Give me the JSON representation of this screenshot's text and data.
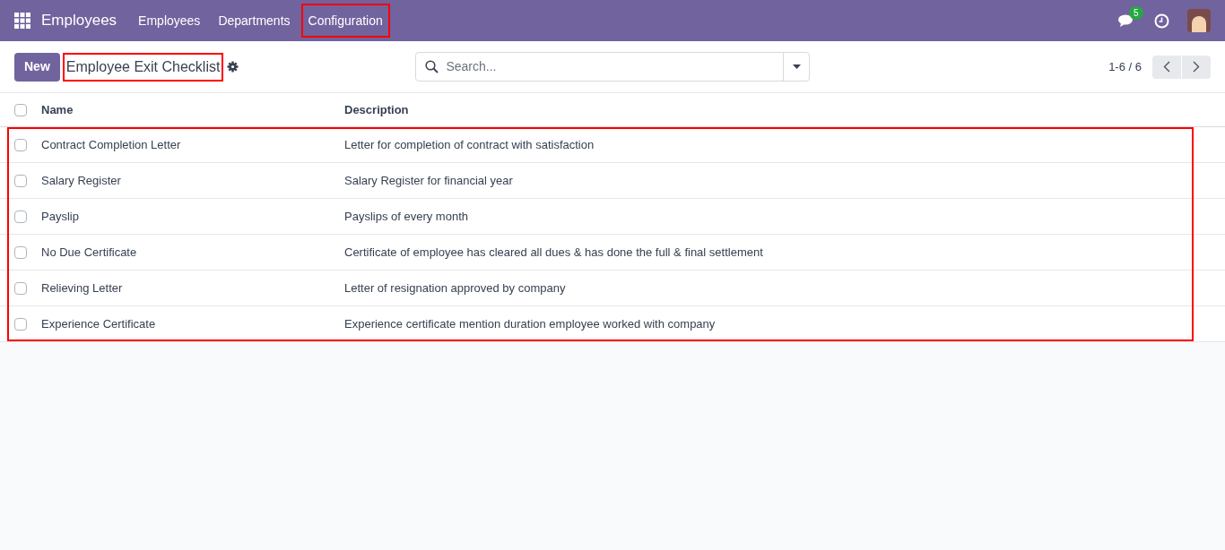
{
  "navbar": {
    "app_title": "Employees",
    "menu": [
      {
        "label": "Employees",
        "highlighted": false
      },
      {
        "label": "Departments",
        "highlighted": false
      },
      {
        "label": "Configuration",
        "highlighted": true
      }
    ],
    "messages_badge": "5"
  },
  "control_panel": {
    "new_button": "New",
    "title": {
      "text": "Employee Exit Checklist",
      "highlighted": true
    },
    "search": {
      "placeholder": "Search..."
    },
    "pager": "1-6 / 6"
  },
  "table": {
    "columns": [
      "Name",
      "Description"
    ],
    "select_all_checked": false,
    "rows_highlighted": true,
    "rows": [
      {
        "name": "Contract Completion Letter",
        "description": "Letter for completion of contract with satisfaction",
        "selected": false
      },
      {
        "name": "Salary Register",
        "description": "Salary Register for financial year",
        "selected": false
      },
      {
        "name": "Payslip",
        "description": "Payslips of every month",
        "selected": false
      },
      {
        "name": "No Due Certificate",
        "description": "Certificate of employee has cleared all dues & has done the full & final settlement",
        "selected": false
      },
      {
        "name": "Relieving Letter",
        "description": "Letter of resignation approved by company",
        "selected": false
      },
      {
        "name": "Experience Certificate",
        "description": "Experience certificate mention duration employee worked with company",
        "selected": false
      }
    ]
  }
}
